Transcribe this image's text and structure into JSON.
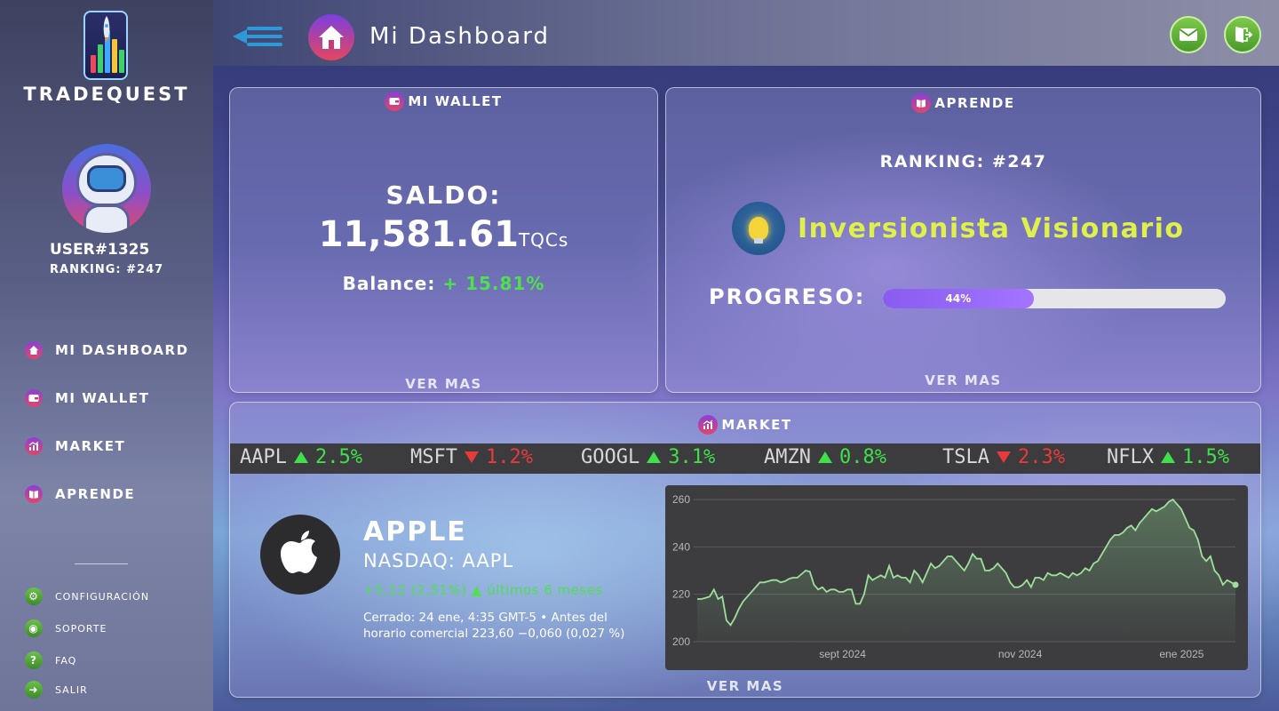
{
  "brand": {
    "name": "TRADEQUEST"
  },
  "user": {
    "name": "USER#1325",
    "ranking": "RANKING: #247"
  },
  "nav": {
    "items": [
      {
        "label": "MI DASHBOARD",
        "icon": "home-icon"
      },
      {
        "label": "MI WALLET",
        "icon": "wallet-icon"
      },
      {
        "label": "MARKET",
        "icon": "chart-icon"
      },
      {
        "label": "APRENDE",
        "icon": "book-icon"
      }
    ],
    "secondary": [
      {
        "label": "CONFIGURACIÓN",
        "icon": "gear-icon"
      },
      {
        "label": "SOPORTE",
        "icon": "support-icon"
      },
      {
        "label": "FAQ",
        "icon": "question-icon"
      },
      {
        "label": "SALIR",
        "icon": "logout-icon"
      }
    ]
  },
  "header": {
    "title": "Mi Dashboard",
    "mail_icon": "mail-icon",
    "exit_icon": "exit-icon"
  },
  "wallet": {
    "title": "MI WALLET",
    "saldo_label": "SALDO:",
    "saldo_value": "11,581.61",
    "saldo_unit": "TQCs",
    "balance_label": "Balance:",
    "balance_value": "+ 15.81%",
    "ver_mas": "VER MAS"
  },
  "aprende": {
    "title": "APRENDE",
    "ranking": "RANKING: #247",
    "achievement": "Inversionista Visionario",
    "progress_label": "PROGRESO:",
    "progress_value": 0.44,
    "progress_text": "44%",
    "ver_mas": "VER MAS"
  },
  "market": {
    "title": "MARKET",
    "ticker": [
      {
        "symbol": "AAPL",
        "change": "2.5%",
        "direction": "up"
      },
      {
        "symbol": "MSFT",
        "change": "1.2%",
        "direction": "down"
      },
      {
        "symbol": "GOOGL",
        "change": "3.1%",
        "direction": "up"
      },
      {
        "symbol": "AMZN",
        "change": "0.8%",
        "direction": "up"
      },
      {
        "symbol": "TSLA",
        "change": "2.3%",
        "direction": "down"
      },
      {
        "symbol": "NFLX",
        "change": "1.5%",
        "direction": "up"
      }
    ],
    "stock": {
      "name": "APPLE",
      "exchange": "NASDAQ: AAPL",
      "change": "+5,12 (2,51%) ▲ últimos 6 meses",
      "closed": "Cerrado: 24 ene, 4:35 GMT-5 • Antes del horario comercial 223,60 −0,060 (0,027 %)"
    },
    "ver_mas": "VER MAS"
  },
  "colors": {
    "positive": "#4ee04e",
    "negative": "#e83a3a",
    "accent": "#8a5cf0",
    "achievement": "#e0f04a"
  },
  "chart_data": {
    "type": "area",
    "ylim": [
      200,
      260
    ],
    "yticks": [
      200,
      220,
      240,
      260
    ],
    "xticks": [
      "sept 2024",
      "nov 2024",
      "ene 2025"
    ],
    "grid": true,
    "series": [
      {
        "values": [
          218,
          218,
          218.5,
          219,
          222,
          218,
          219,
          209,
          207,
          210,
          214,
          217,
          219,
          221,
          223,
          225,
          225,
          225.5,
          226,
          226,
          225,
          225.5,
          226.5,
          227,
          227,
          228.5,
          230,
          229.5,
          224,
          222,
          223,
          221,
          222,
          222,
          221,
          221,
          222,
          222,
          216,
          216,
          220,
          228,
          226,
          227,
          228,
          227,
          232,
          227,
          228,
          227,
          227,
          225,
          230,
          228,
          225,
          229,
          233,
          231,
          232,
          234,
          236,
          236,
          234,
          232,
          230,
          233,
          237,
          235,
          235,
          230,
          230,
          231,
          233,
          231,
          229,
          225,
          223,
          223,
          224,
          226,
          223,
          227,
          227,
          226,
          229,
          228,
          228,
          229,
          228,
          227,
          229,
          228,
          229,
          231,
          230,
          233,
          234,
          237,
          240,
          243,
          245,
          245,
          246,
          248,
          249,
          247,
          250,
          252,
          254,
          256,
          255,
          256,
          257,
          259,
          260,
          258,
          256,
          252,
          248,
          247,
          243,
          236,
          234,
          236,
          230,
          228,
          224,
          226,
          225,
          224
        ]
      }
    ]
  }
}
